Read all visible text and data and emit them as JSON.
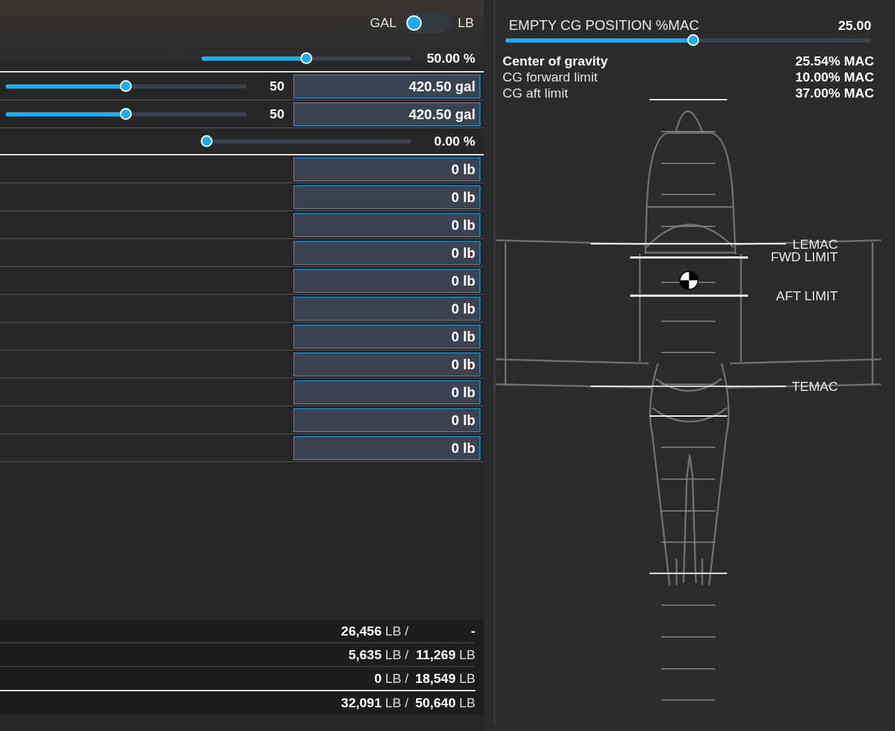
{
  "unit_toggle": {
    "left_label": "GAL",
    "right_label": "LB",
    "on": false
  },
  "load_rows": [
    {
      "kind": "percent",
      "level": 0.5,
      "reading": "50.00 %"
    },
    {
      "kind": "tank",
      "level": 0.5,
      "count": "50",
      "value": "420.50 gal"
    },
    {
      "kind": "tank",
      "level": 0.5,
      "count": "50",
      "value": "420.50 gal"
    },
    {
      "kind": "percent",
      "level": 0,
      "reading": "0.00 %"
    },
    {
      "kind": "weight",
      "value": "0 lb"
    },
    {
      "kind": "weight",
      "value": "0 lb"
    },
    {
      "kind": "weight",
      "value": "0 lb"
    },
    {
      "kind": "weight",
      "value": "0 lb"
    },
    {
      "kind": "weight",
      "value": "0 lb"
    },
    {
      "kind": "weight",
      "value": "0 lb"
    },
    {
      "kind": "weight",
      "value": "0 lb"
    },
    {
      "kind": "weight",
      "value": "0 lb"
    },
    {
      "kind": "weight",
      "value": "0 lb"
    },
    {
      "kind": "weight",
      "value": "0 lb"
    },
    {
      "kind": "weight",
      "value": "0 lb"
    }
  ],
  "summary": [
    {
      "kind": "item",
      "value": "26,456",
      "unit": "LB",
      "separator": "/",
      "limit": "-"
    },
    {
      "kind": "item",
      "value": "5,635",
      "unit": "LB",
      "separator": "/",
      "limit": "11,269",
      "limit_unit": "LB"
    },
    {
      "kind": "item",
      "value": "0",
      "unit": "LB",
      "separator": "/",
      "limit": "18,549",
      "limit_unit": "LB"
    },
    {
      "kind": "total",
      "value": "32,091",
      "unit": "LB",
      "separator": "/",
      "limit": "50,640",
      "limit_unit": "LB"
    }
  ],
  "empty_cg": {
    "label": "EMPTY CG POSITION %MAC",
    "value": "25.00",
    "level": 0.515
  },
  "cg_info": [
    {
      "label": "Center of gravity",
      "value": "25.54% MAC",
      "emphasis": true
    },
    {
      "label": "CG forward limit",
      "value": "10.00% MAC",
      "emphasis": false
    },
    {
      "label": "CG aft limit",
      "value": "37.00% MAC",
      "emphasis": false
    }
  ],
  "cg_diagram": {
    "markers": [
      {
        "kind": "lemac",
        "label": "LEMAC"
      },
      {
        "kind": "fwd",
        "label": "FWD LIMIT"
      },
      {
        "kind": "aft",
        "label": "AFT LIMIT"
      },
      {
        "kind": "temac",
        "label": "TEMAC"
      }
    ]
  }
}
